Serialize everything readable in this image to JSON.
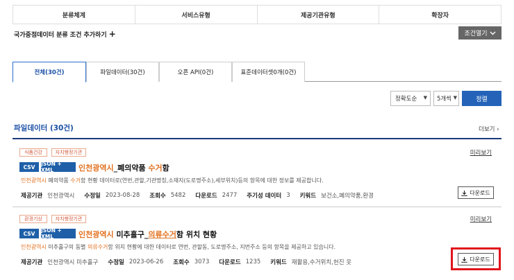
{
  "filters": {
    "tabs": [
      "분류체계",
      "서비스유형",
      "제공기관유형",
      "확장자"
    ],
    "add_condition": "국가중점데이터 분류 조건 추가하기",
    "add_icon": "plus-icon",
    "open_condition": "조건열기"
  },
  "type_tabs": [
    {
      "label": "전체(30건)",
      "active": true
    },
    {
      "label": "파일데이터(30건)",
      "active": false
    },
    {
      "label": "오픈 API(0건)",
      "active": false
    },
    {
      "label": "표준데이터셋0개(0건)",
      "active": false
    }
  ],
  "sort": {
    "order": "정확도순",
    "per_page": "5개씩",
    "button": "정렬"
  },
  "section": {
    "title": "파일데이터 (30건)",
    "more": "더보기 ›"
  },
  "items": [
    {
      "badges": [
        "식품건강",
        "자치행정기관"
      ],
      "formats": [
        "CSV",
        "JSON + XML"
      ],
      "title_hl": "인천광역시",
      "title_mid": "_폐의약품 ",
      "title_hl2": "수거",
      "title_end": "함",
      "desc_hl": "인천광역시",
      "desc_a": " 폐의약품 ",
      "desc_hl2": "수거",
      "desc_b": "함 현황 데이터로(연번,관할,기관명칭,소재지(도로명주소),세부위치)등의 항목에 대한 정보를 제공합니다.",
      "meta": {
        "provider_label": "제공기관",
        "provider": "인천광역시",
        "modified_label": "수정일",
        "modified": "2023-08-28",
        "views_label": "조회수",
        "views": "5482",
        "downloads_label": "다운로드",
        "downloads": "2477",
        "periodic_label": "주기성 데이터",
        "periodic": "3",
        "keywords_label": "키워드",
        "keywords": "보건소,폐의약품,환경"
      },
      "preview": "미리보기",
      "download": "다운로드"
    },
    {
      "badges": [
        "환경기상",
        "자치행정기관"
      ],
      "formats": [
        "CSV",
        "JSON + XML"
      ],
      "title_hl": "인천광역시",
      "title_mid": " 미추홀구_",
      "title_hl2": "의류수거",
      "title_end": "함 위치 현황",
      "desc_hl": "인천광역시",
      "desc_a": " 미추홀구의 동별 ",
      "desc_hl2": "의류수거",
      "desc_b": "함 위치 현황에 대한 데이터로 연번, 관할동, 도로명주소, 지번주소 등의 항목을 제공하고 있습니다.",
      "meta": {
        "provider_label": "제공기관",
        "provider": "인천광역시 미추홀구",
        "modified_label": "수정일",
        "modified": "2023-06-26",
        "views_label": "조회수",
        "views": "3073",
        "downloads_label": "다운로드",
        "downloads": "1235",
        "keywords_label": "키워드",
        "keywords": "재활용,수거위치,헌진 옷"
      },
      "preview": "미리보기",
      "download": "다운로드"
    }
  ],
  "highlight_color": "#e0141c",
  "accent_color": "#1e5fa8"
}
